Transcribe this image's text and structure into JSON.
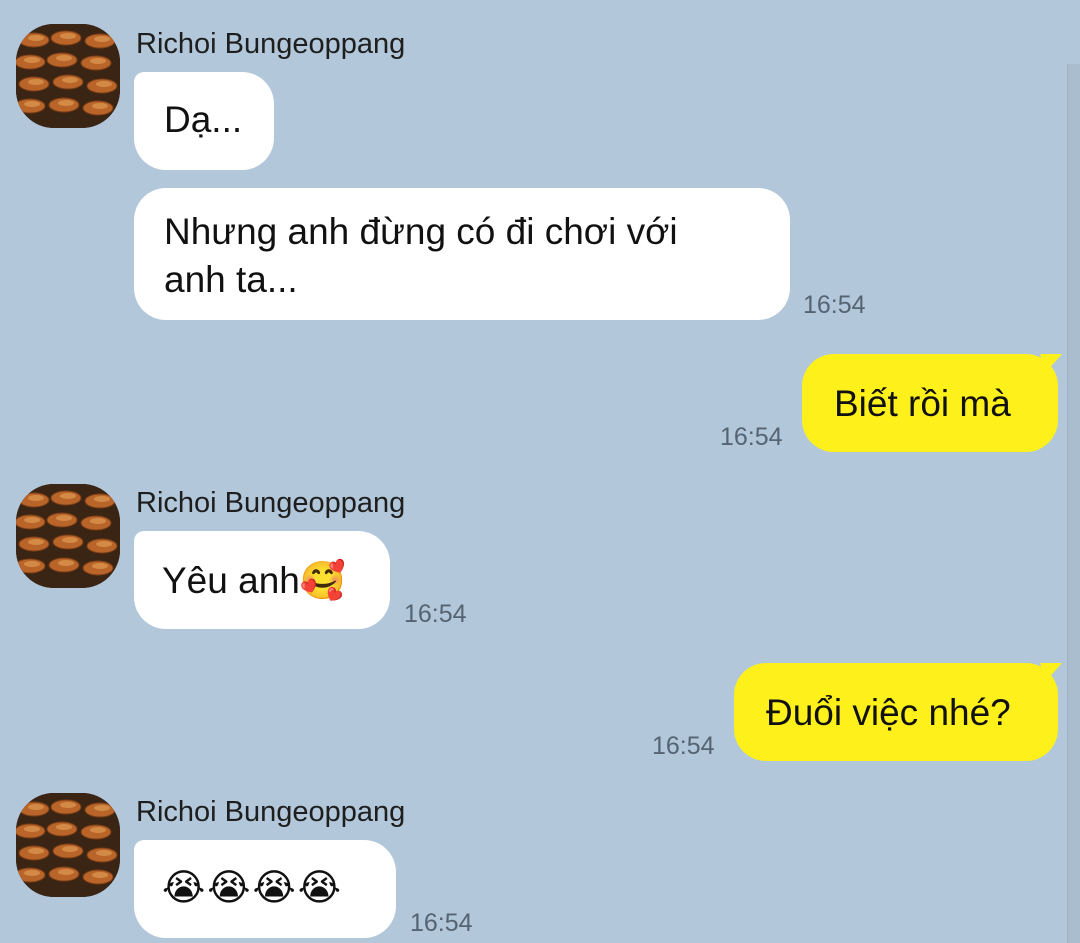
{
  "messages": [
    {
      "sender": "Richoi Bungeoppang",
      "text": "Dạ...",
      "time": ""
    },
    {
      "sender": "",
      "text": "Nhưng anh đừng có đi chơi với\nanh ta...",
      "time": "16:54"
    },
    {
      "sender": "me",
      "text": "Biết rồi mà",
      "time": "16:54"
    },
    {
      "sender": "Richoi Bungeoppang",
      "text": "Yêu anh🥰",
      "time": "16:54"
    },
    {
      "sender": "me",
      "text": "Đuổi việc nhé?",
      "time": "16:54"
    },
    {
      "sender": "Richoi Bungeoppang",
      "text": "😭😭😭😭",
      "time": "16:54"
    }
  ],
  "avatar_icon": "bungeoppang-fish-bread-photo",
  "colors": {
    "background": "#b2c7da",
    "incoming_bubble": "#ffffff",
    "outgoing_bubble": "#fef01b"
  }
}
